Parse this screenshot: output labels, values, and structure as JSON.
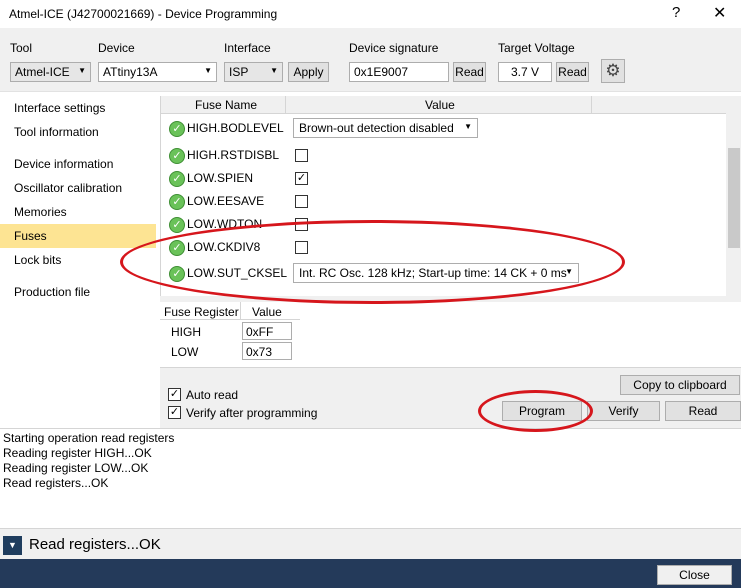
{
  "window": {
    "title": "Atmel-ICE (J42700021669) - Device Programming",
    "help_glyph": "?",
    "close_glyph": "✕"
  },
  "toolbar": {
    "tool_label": "Tool",
    "tool_value": "Atmel-ICE",
    "device_label": "Device",
    "device_value": "ATtiny13A",
    "interface_label": "Interface",
    "interface_value": "ISP",
    "apply_label": "Apply",
    "signature_label": "Device signature",
    "signature_value": "0x1E9007",
    "signature_read_label": "Read",
    "voltage_label": "Target Voltage",
    "voltage_value": "3.7 V",
    "voltage_read_label": "Read",
    "settings_icon": "gear-icon"
  },
  "sidebar": {
    "items": [
      {
        "label": "Interface settings"
      },
      {
        "label": "Tool information"
      },
      {
        "label": "Device information"
      },
      {
        "label": "Oscillator calibration"
      },
      {
        "label": "Memories"
      },
      {
        "label": "Fuses"
      },
      {
        "label": "Lock bits"
      },
      {
        "label": "Production file"
      }
    ],
    "selected": "Fuses"
  },
  "fuses": {
    "col_name": "Fuse Name",
    "col_value": "Value",
    "rows": [
      {
        "name": "HIGH.BODLEVEL",
        "type": "select",
        "value": "Brown-out detection disabled"
      },
      {
        "name": "HIGH.RSTDISBL",
        "type": "checkbox",
        "checked": false
      },
      {
        "name": "LOW.SPIEN",
        "type": "checkbox",
        "checked": true
      },
      {
        "name": "LOW.EESAVE",
        "type": "checkbox",
        "checked": false
      },
      {
        "name": "LOW.WDTON",
        "type": "checkbox",
        "checked": false
      },
      {
        "name": "LOW.CKDIV8",
        "type": "checkbox",
        "checked": false
      },
      {
        "name": "LOW.SUT_CKSEL",
        "type": "select",
        "value": "Int. RC Osc. 128 kHz; Start-up time: 14 CK + 0 ms"
      }
    ]
  },
  "registers": {
    "col_name": "Fuse Register",
    "col_value": "Value",
    "rows": [
      {
        "name": "HIGH",
        "value": "0xFF"
      },
      {
        "name": "LOW",
        "value": "0x73"
      }
    ]
  },
  "actions": {
    "auto_read_label": "Auto read",
    "auto_read_checked": true,
    "verify_label": "Verify after programming",
    "verify_checked": true,
    "copy_label": "Copy to clipboard",
    "program_label": "Program",
    "verify_button_label": "Verify",
    "read_label": "Read"
  },
  "log": {
    "lines": [
      "Starting operation read registers",
      "Reading register HIGH...OK",
      "Reading register LOW...OK",
      "Read registers...OK"
    ]
  },
  "status": {
    "message": "Read registers...OK"
  },
  "footer": {
    "close_label": "Close"
  },
  "colors": {
    "selected_nav": "#fde493",
    "annotation_red": "#d6161c",
    "footer_bg": "#243a5a"
  }
}
